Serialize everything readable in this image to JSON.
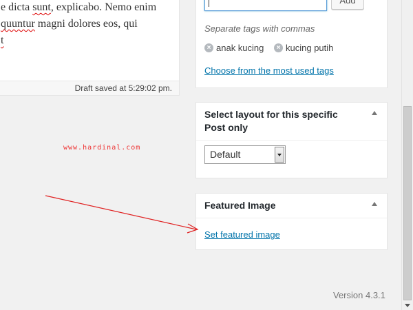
{
  "editor": {
    "lines": [
      {
        "pre": "e dicta ",
        "spell1": "sunt",
        "mid": ", explicabo. Nemo enim"
      },
      {
        "pre": "",
        "spell1": "quuntur",
        "mid": " magni dolores eos, qui"
      },
      {
        "pre": "",
        "spell1": "t",
        "mid": ""
      }
    ],
    "status": "Draft saved at 5:29:02 pm."
  },
  "tags": {
    "add_label": "Add",
    "hint": "Separate tags with commas",
    "items": [
      "anak kucing",
      "kucing putih"
    ],
    "choose_link": "Choose from the most used tags"
  },
  "layout_box": {
    "title": "Select layout for this specific Post only",
    "selected": "Default"
  },
  "featured_box": {
    "title": "Featured Image",
    "link": "Set featured image"
  },
  "watermark": "www.hardinal.com",
  "footer": {
    "version": "Version 4.3.1"
  },
  "colors": {
    "link": "#0073aa",
    "annotation": "#e02020",
    "background": "#f1f1f1"
  }
}
